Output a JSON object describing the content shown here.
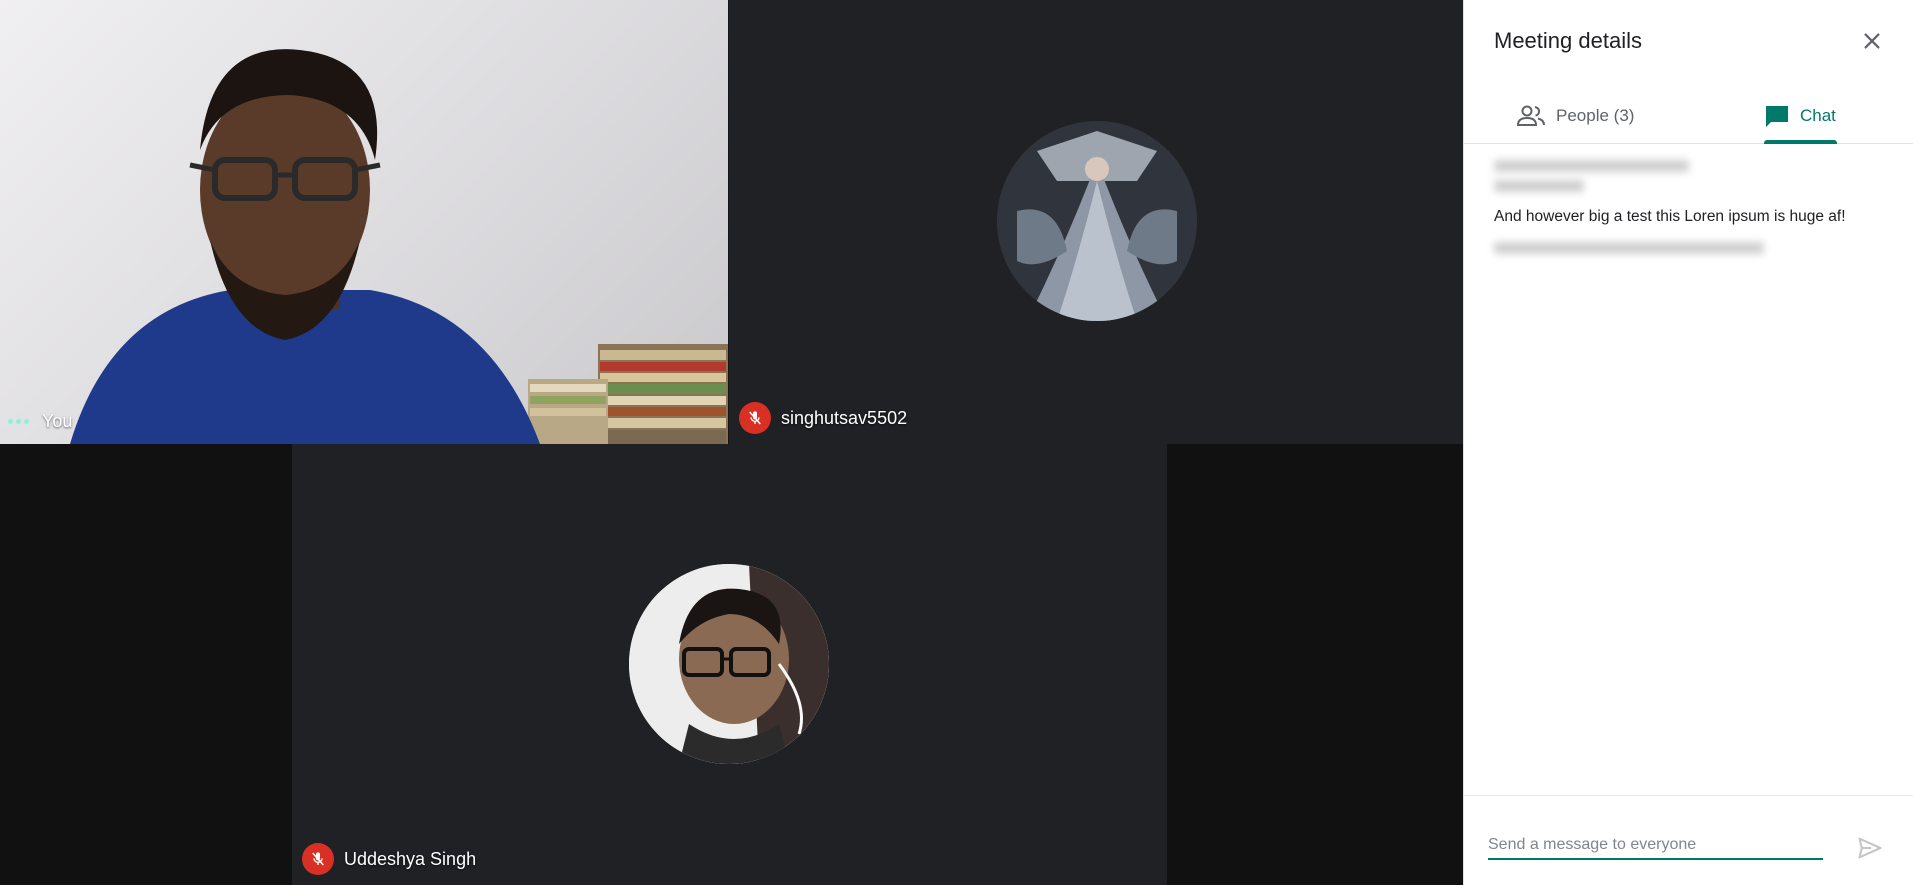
{
  "participants": {
    "you": {
      "label": "You"
    },
    "singh": {
      "label": "singhutsav5502"
    },
    "uddeshya": {
      "label": "Uddeshya Singh"
    }
  },
  "panel": {
    "title": "Meeting details",
    "tabs": {
      "people": {
        "label": "People (3)"
      },
      "chat": {
        "label": "Chat"
      }
    },
    "chat": {
      "messages": [
        {
          "text": "And however big a test this Loren ipsum is huge af!"
        }
      ]
    },
    "composer": {
      "placeholder": "Send a message to everyone"
    }
  },
  "colors": {
    "accent": "#00796b",
    "mic_off": "#d93025",
    "tile_bg": "#202124",
    "stage_bg": "#111111"
  },
  "icons": {
    "close": "close-icon",
    "people": "people-icon",
    "chat": "chat-icon",
    "send": "send-icon",
    "mic_off": "mic-off-icon",
    "more": "more-dots-icon"
  }
}
